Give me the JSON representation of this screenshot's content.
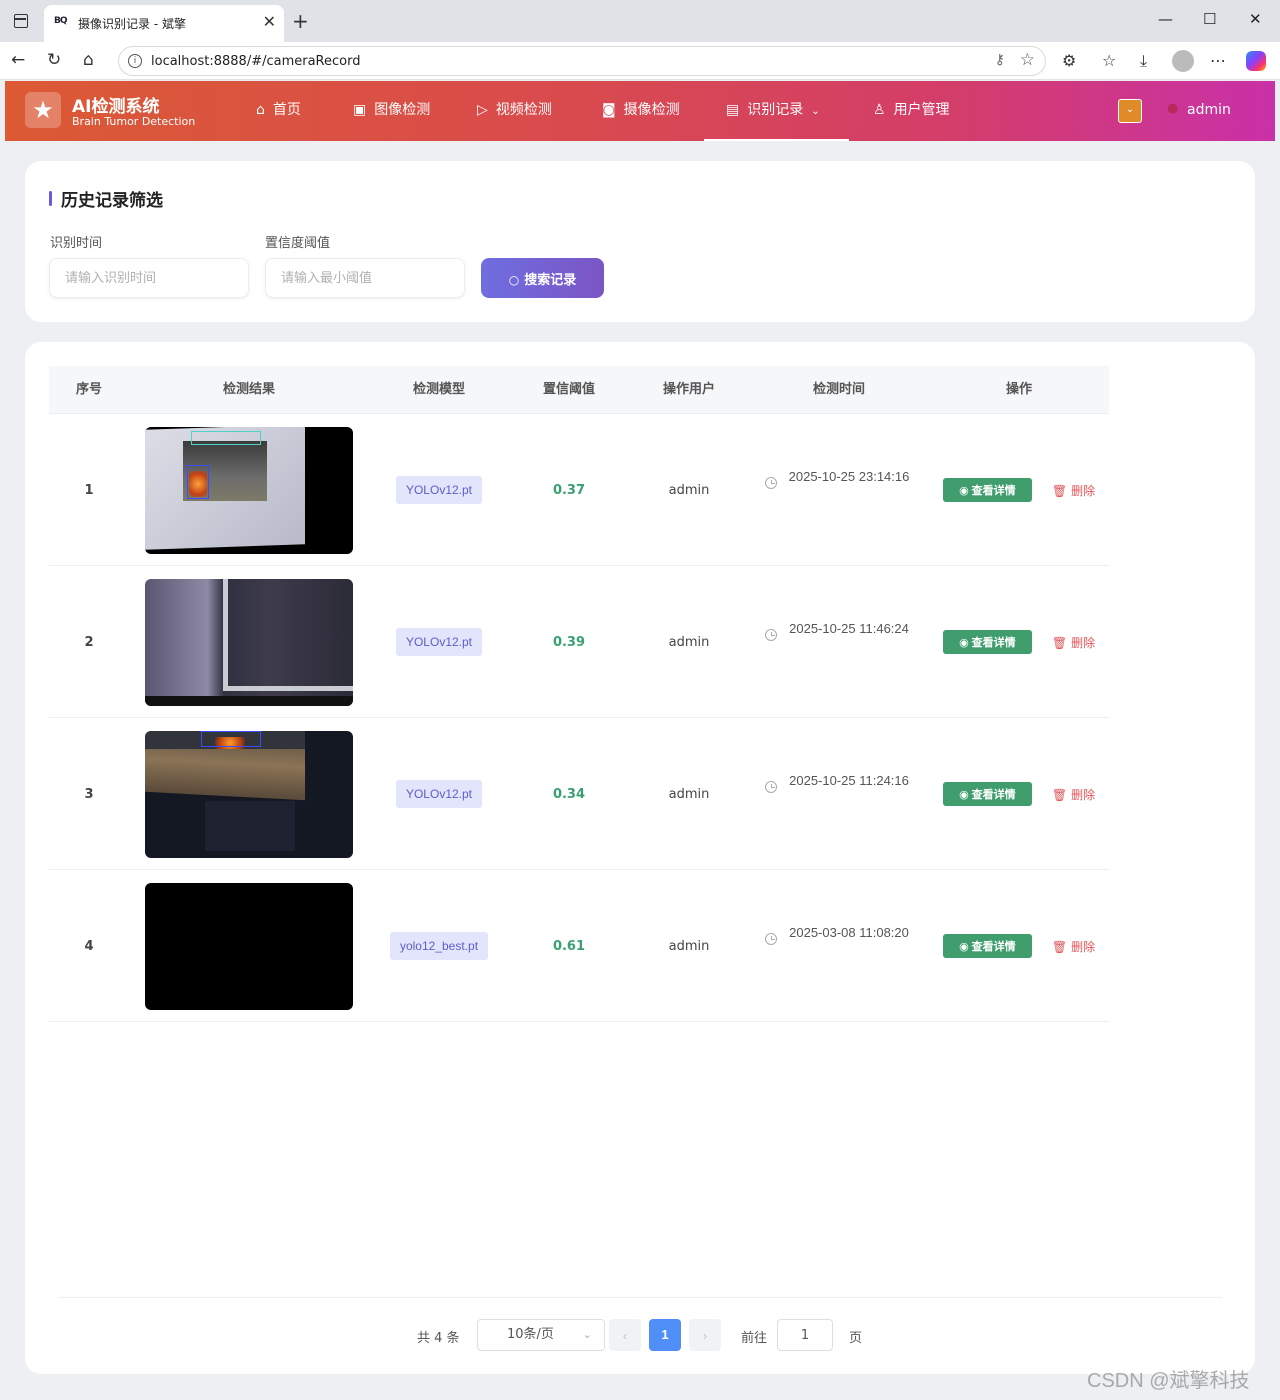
{
  "browser": {
    "tab_title": "摄像识别记录 - 斌擎",
    "tab_favicon": "BQ",
    "url": "localhost:8888/#/cameraRecord"
  },
  "app": {
    "title": "AI检测系统",
    "subtitle": "Brain Tumor Detection",
    "nav": [
      {
        "label": "首页",
        "icon": "home-icon"
      },
      {
        "label": "图像检测",
        "icon": "image-icon"
      },
      {
        "label": "视频检测",
        "icon": "play-icon"
      },
      {
        "label": "摄像检测",
        "icon": "camera-icon"
      },
      {
        "label": "识别记录",
        "icon": "document-icon",
        "active": true
      },
      {
        "label": "用户管理",
        "icon": "user-icon"
      }
    ],
    "username": "admin",
    "colors": {
      "header_start": "#db5a34",
      "header_end": "#c931a8",
      "accent": "#6f6ee0",
      "success": "#3f9d6e",
      "danger": "#e2545a"
    }
  },
  "filter": {
    "title": "历史记录筛选",
    "time_label": "识别时间",
    "time_placeholder": "请输入识别时间",
    "conf_label": "置信度阈值",
    "conf_placeholder": "请输入最小阈值",
    "search_label": "搜索记录"
  },
  "table": {
    "headers": [
      "序号",
      "检测结果",
      "检测模型",
      "置信阈值",
      "操作用户",
      "检测时间",
      "操作"
    ],
    "rows": [
      {
        "index": "1",
        "model": "YOLOv12.pt",
        "confidence": "0.37",
        "user": "admin",
        "time": "2025-10-25 23:14:16",
        "view": "查看详情",
        "delete": "删除"
      },
      {
        "index": "2",
        "model": "YOLOv12.pt",
        "confidence": "0.39",
        "user": "admin",
        "time": "2025-10-25 11:46:24",
        "view": "查看详情",
        "delete": "删除"
      },
      {
        "index": "3",
        "model": "YOLOv12.pt",
        "confidence": "0.34",
        "user": "admin",
        "time": "2025-10-25 11:24:16",
        "view": "查看详情",
        "delete": "删除"
      },
      {
        "index": "4",
        "model": "yolo12_best.pt",
        "confidence": "0.61",
        "user": "admin",
        "time": "2025-03-08 11:08:20",
        "view": "查看详情",
        "delete": "删除"
      }
    ]
  },
  "pagination": {
    "total": "共 4 条",
    "page_size": "10条/页",
    "current_page": "1",
    "goto_label": "前往",
    "goto_value": "1",
    "page_unit": "页"
  },
  "watermark": "CSDN @斌擎科技"
}
